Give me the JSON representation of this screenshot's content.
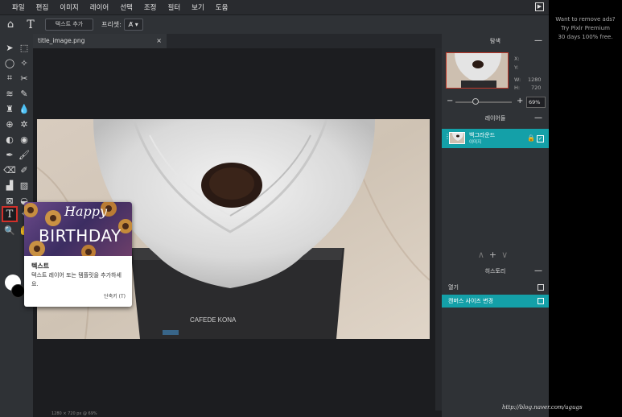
{
  "menu": [
    "파일",
    "편집",
    "이미지",
    "레이어",
    "선택",
    "조정",
    "필터",
    "보기",
    "도움"
  ],
  "options": {
    "add_text": "텍스트 추가",
    "preset_label": "프리셋:",
    "preset_value": "A̸"
  },
  "document": {
    "tab_title": "title_image.png",
    "close": "×",
    "status": "1280 × 720 px @ 69%"
  },
  "navigator": {
    "title": "탐색",
    "x_label": "X:",
    "y_label": "Y:",
    "w_label": "W:",
    "w_value": "1280",
    "h_label": "H:",
    "h_value": "720",
    "zoom": "69%",
    "zoom_fraction": 0.36
  },
  "layers": {
    "title": "레이어들",
    "items": [
      {
        "name": "백그라운드",
        "type": "이미지"
      }
    ]
  },
  "history": {
    "title": "히스토리",
    "items": [
      {
        "label": "열기",
        "active": false
      },
      {
        "label": "캔버스 사이즈 변경",
        "active": true
      }
    ]
  },
  "tooltip": {
    "happy": "Happy",
    "birthday": "BIRTHDAY",
    "title": "텍스트",
    "description": "텍스트 레이어 또는 템플릿을 추가하세요.",
    "shortcut": "단축키 (T)"
  },
  "ad": {
    "line1": "Want to remove ads?",
    "line2": "Try Pixlr Premium",
    "line3": "30 days 100% free."
  },
  "watermark": "http://blog.naver.com/ugugs",
  "colors": {
    "accent": "#14a0a8",
    "active_tool_border": "#d0302a",
    "foreground": "#ffffff",
    "background": "#000000"
  }
}
